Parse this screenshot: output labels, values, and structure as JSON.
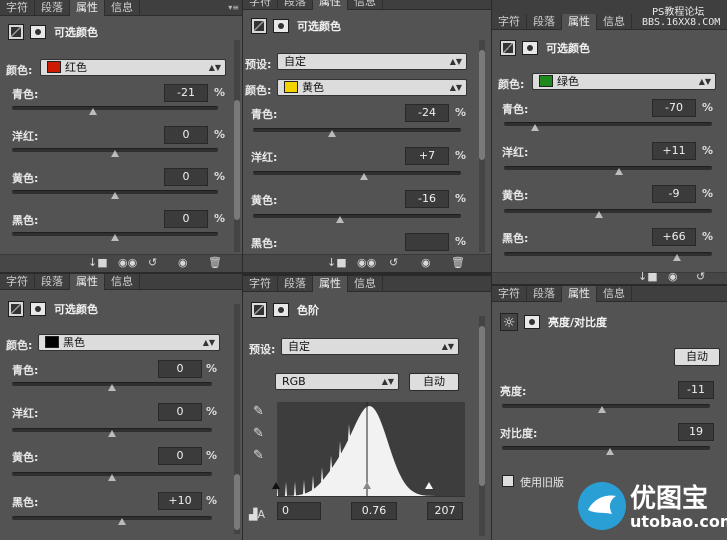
{
  "watermark_top": "PS教程论坛",
  "watermark_site": "BBS.16XX8.COM",
  "tabs": [
    "字符",
    "段落",
    "属性",
    "信息"
  ],
  "selective_color_title": "可选颜色",
  "color_label": "颜色:",
  "preset_label": "预设:",
  "preset_value": "自定",
  "channel_labels": {
    "cyan": "青色:",
    "magenta": "洋红:",
    "yellow": "黄色:",
    "black": "黑色:"
  },
  "percent": "%",
  "panel_red": {
    "color": "红色",
    "color_hex": "#cc1b00",
    "cyan": "-21",
    "magenta": "0",
    "yellow": "0",
    "black": "0",
    "levels": [
      0.395,
      0.5,
      0.5,
      0.5
    ]
  },
  "panel_yellow": {
    "color": "黄色",
    "color_hex": "#f3d200",
    "cyan": "-24",
    "magenta": "+7",
    "yellow": "-16",
    "black": "",
    "levels": [
      0.38,
      0.535,
      0.42,
      0.5
    ]
  },
  "panel_green": {
    "color": "绿色",
    "color_hex": "#1f8a1b",
    "cyan": "-70",
    "magenta": "+11",
    "yellow": "-9",
    "black": "+66",
    "levels": [
      0.15,
      0.555,
      0.455,
      0.83
    ]
  },
  "panel_black": {
    "color": "黑色",
    "color_hex": "#000000",
    "cyan": "0",
    "magenta": "0",
    "yellow": "0",
    "black": "+10",
    "levels": [
      0.5,
      0.5,
      0.5,
      0.55
    ]
  },
  "levels_panel": {
    "title": "色阶",
    "preset_value": "自定",
    "channel": "RGB",
    "auto_button": "自动",
    "input_black": "0",
    "input_mid": "0.76",
    "input_white": "207"
  },
  "brightness_panel": {
    "title": "亮度/对比度",
    "auto_button": "自动",
    "brightness_label": "亮度:",
    "brightness_value": "-11",
    "contrast_label": "对比度:",
    "contrast_value": "19",
    "legacy_label": "使用旧版",
    "brightness_level": 0.48,
    "contrast_level": 0.52
  },
  "logo": {
    "text": "优图宝",
    "url": "utobao.com"
  }
}
